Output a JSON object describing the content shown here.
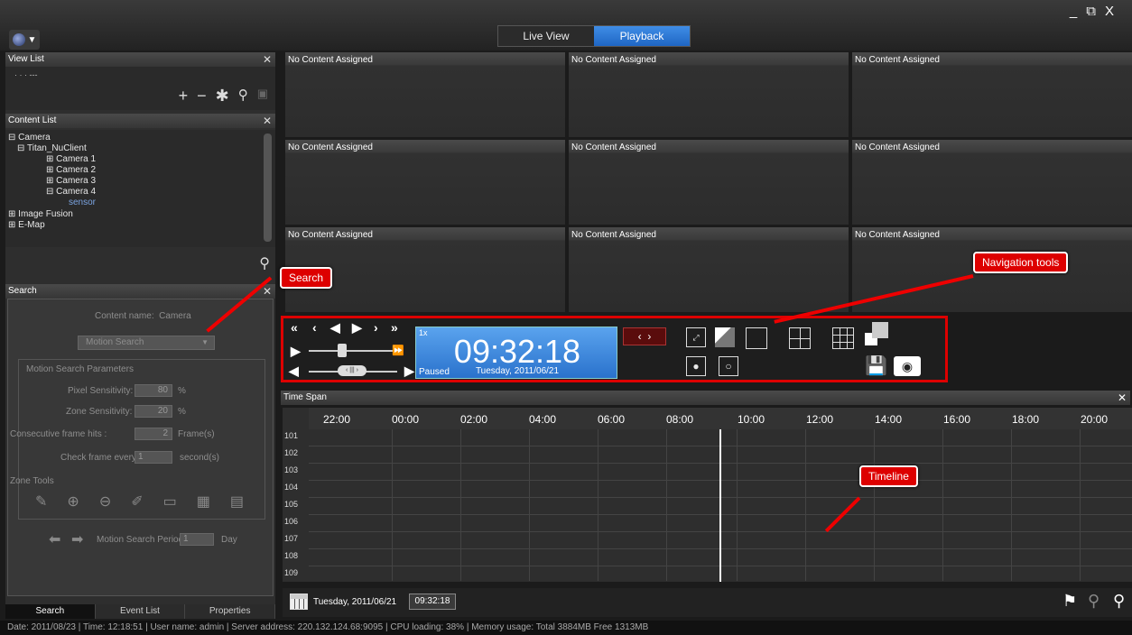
{
  "window": {
    "minimize": "_",
    "restore": "⧉",
    "close": "X"
  },
  "mode_tabs": [
    {
      "label": "Live View"
    },
    {
      "label": "Playback"
    }
  ],
  "view_list": {
    "title": "View List",
    "dots": "· · ·  ---"
  },
  "content_list": {
    "title": "Content List",
    "tree": [
      {
        "label": "Camera",
        "toggle": "⊟"
      },
      {
        "label": "Titan_NuClient",
        "toggle": "⊟"
      },
      {
        "label": "Camera 1",
        "toggle": "⊞"
      },
      {
        "label": "Camera 2",
        "toggle": "⊞"
      },
      {
        "label": "Camera 3",
        "toggle": "⊞"
      },
      {
        "label": "Camera 4",
        "toggle": "⊟"
      },
      {
        "label": "sensor",
        "toggle": ""
      },
      {
        "label": "Image Fusion",
        "toggle": "⊞"
      },
      {
        "label": "E-Map",
        "toggle": "⊞"
      }
    ]
  },
  "search": {
    "title": "Search",
    "content_name_label": "Content name:",
    "content_name_value": "Camera",
    "search_type": "Motion Search",
    "params_title": "Motion Search Parameters",
    "pixel_sensitivity_label": "Pixel Sensitivity:",
    "pixel_sensitivity_value": "80",
    "pixel_unit": "%",
    "zone_sensitivity_label": "Zone Sensitivity:",
    "zone_sensitivity_value": "20",
    "zone_unit": "%",
    "consecutive_label": "Consecutive frame hits :",
    "consecutive_value": "2",
    "consecutive_unit": "Frame(s)",
    "check_label": "Check frame every",
    "check_value": "1",
    "check_unit": "second(s)",
    "zone_tools_label": "Zone Tools",
    "period_label": "Motion Search Period",
    "period_value": "1",
    "period_unit": "Day"
  },
  "bottom_tabs": [
    {
      "label": "Search"
    },
    {
      "label": "Event List"
    },
    {
      "label": "Properties"
    }
  ],
  "grid_cells": [
    "No Content Assigned",
    "No Content Assigned",
    "No Content Assigned",
    "No Content Assigned",
    "No Content Assigned",
    "No Content Assigned",
    "No Content Assigned",
    "No Content Assigned",
    "No Content Assigned"
  ],
  "playback": {
    "time": "09:32:18",
    "date": "Tuesday, 2011/06/21",
    "speed": "1x",
    "state": "Paused"
  },
  "timeline": {
    "title": "Time Span",
    "hours": [
      "22:00",
      "00:00",
      "02:00",
      "04:00",
      "06:00",
      "08:00",
      "10:00",
      "12:00",
      "14:00",
      "16:00",
      "18:00",
      "20:00"
    ],
    "rows": [
      "101",
      "102",
      "103",
      "104",
      "105",
      "106",
      "107",
      "108",
      "109"
    ],
    "footer_date": "Tuesday, 2011/06/21",
    "footer_time": "09:32:18"
  },
  "status_bar": "Date: 2011/08/23  |  Time: 12:18:51  |  User name: admin  |  Server address: 220.132.124.68:9095  |  CPU loading: 38%  |  Memory usage: Total 3884MB  Free 1313MB",
  "callouts": {
    "search": "Search",
    "navigation": "Navigation tools",
    "timeline": "Timeline"
  },
  "colors": {
    "accent": "#2a72cc",
    "callout": "#dd0000"
  }
}
